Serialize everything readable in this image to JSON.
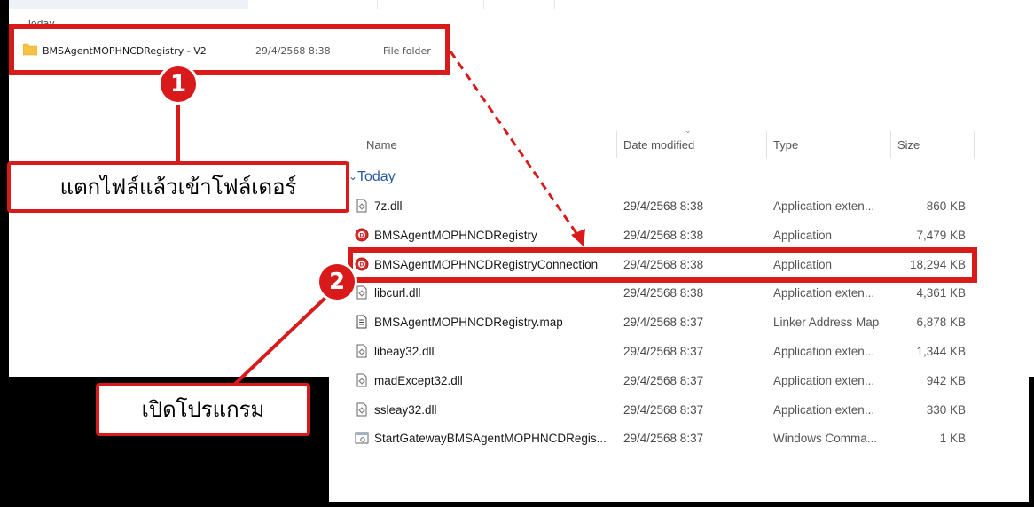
{
  "top_list": {
    "group_label": "Today",
    "folder": {
      "name": "BMSAgentMOPHNCDRegistry - V2",
      "date": "29/4/2568 8:38",
      "type": "File folder"
    }
  },
  "list": {
    "columns": {
      "name": "Name",
      "date": "Date modified",
      "type": "Type",
      "size": "Size"
    },
    "group_label": "Today",
    "rows": [
      {
        "name": "7z.dll",
        "date": "29/4/2568 8:38",
        "type": "Application exten...",
        "size": "860 KB",
        "icon": "dll-file-icon"
      },
      {
        "name": "BMSAgentMOPHNCDRegistry",
        "date": "29/4/2568 8:38",
        "type": "Application",
        "size": "7,479 KB",
        "icon": "app-icon"
      },
      {
        "name": "BMSAgentMOPHNCDRegistryConnection",
        "date": "29/4/2568 8:38",
        "type": "Application",
        "size": "18,294 KB",
        "icon": "app-icon"
      },
      {
        "name": "libcurl.dll",
        "date": "29/4/2568 8:38",
        "type": "Application exten...",
        "size": "4,361 KB",
        "icon": "dll-file-icon"
      },
      {
        "name": "BMSAgentMOPHNCDRegistry.map",
        "date": "29/4/2568 8:37",
        "type": "Linker Address Map",
        "size": "6,878 KB",
        "icon": "text-file-icon"
      },
      {
        "name": "libeay32.dll",
        "date": "29/4/2568 8:37",
        "type": "Application exten...",
        "size": "1,344 KB",
        "icon": "dll-file-icon"
      },
      {
        "name": "madExcept32.dll",
        "date": "29/4/2568 8:37",
        "type": "Application exten...",
        "size": "942 KB",
        "icon": "dll-file-icon"
      },
      {
        "name": "ssleay32.dll",
        "date": "29/4/2568 8:37",
        "type": "Application exten...",
        "size": "330 KB",
        "icon": "dll-file-icon"
      },
      {
        "name": "StartGatewayBMSAgentMOPHNCDRegis...",
        "date": "29/4/2568 8:37",
        "type": "Windows Comma...",
        "size": "1 KB",
        "icon": "cmd-file-icon"
      }
    ]
  },
  "annotations": {
    "step1": {
      "number": "1",
      "text": "แตกไฟล์แล้วเข้าโฟล์เดอร์"
    },
    "step2": {
      "number": "2",
      "text": "เปิดโปรแกรม"
    }
  },
  "colors": {
    "accent_red": "#d91a1a",
    "group_blue": "#2c5aa0",
    "folder_yellow": "#f5c242"
  }
}
